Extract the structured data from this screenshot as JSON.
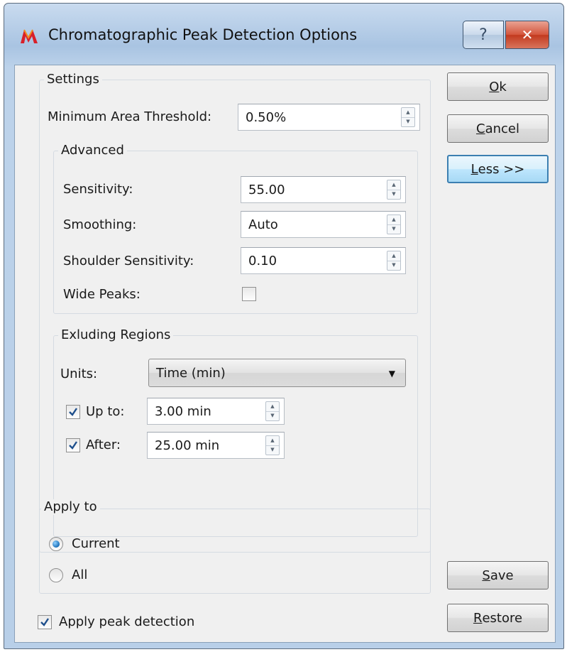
{
  "window": {
    "title": "Chromatographic Peak Detection Options",
    "help_glyph": "?",
    "close_glyph": "✕"
  },
  "settings": {
    "group_label": "Settings",
    "min_area_label": "Minimum Area Threshold:",
    "min_area_value": "0.50%",
    "advanced": {
      "group_label": "Advanced",
      "sensitivity_label": "Sensitivity:",
      "sensitivity_value": "55.00",
      "smoothing_label": "Smoothing:",
      "smoothing_value": "Auto",
      "shoulder_label": "Shoulder Sensitivity:",
      "shoulder_value": "0.10",
      "wide_peaks_label": "Wide Peaks:",
      "wide_peaks_checked": false
    },
    "excluding": {
      "group_label": "Exluding Regions",
      "units_label": "Units:",
      "units_value": "Time (min)",
      "up_to_label": "Up to:",
      "up_to_checked": true,
      "up_to_value": "3.00 min",
      "after_label": "After:",
      "after_checked": true,
      "after_value": "25.00 min"
    }
  },
  "apply_to": {
    "group_label": "Apply to",
    "options": [
      {
        "label": "Current",
        "selected": true
      },
      {
        "label": "All",
        "selected": false
      }
    ]
  },
  "apply_peak_detection": {
    "label": "Apply peak detection",
    "checked": true
  },
  "buttons": {
    "ok": {
      "mnemonic": "O",
      "rest": "k"
    },
    "cancel": {
      "mnemonic": "C",
      "rest": "ancel"
    },
    "less": {
      "mnemonic": "L",
      "rest": "ess >>"
    },
    "save": {
      "mnemonic": "S",
      "rest": "ave"
    },
    "restore": {
      "mnemonic": "R",
      "rest": "estore"
    }
  },
  "colors": {
    "accent": "#3c7fb1",
    "title_bar": "#b8cfe8",
    "close": "#c23a1f",
    "face": "#f0f0f0"
  }
}
